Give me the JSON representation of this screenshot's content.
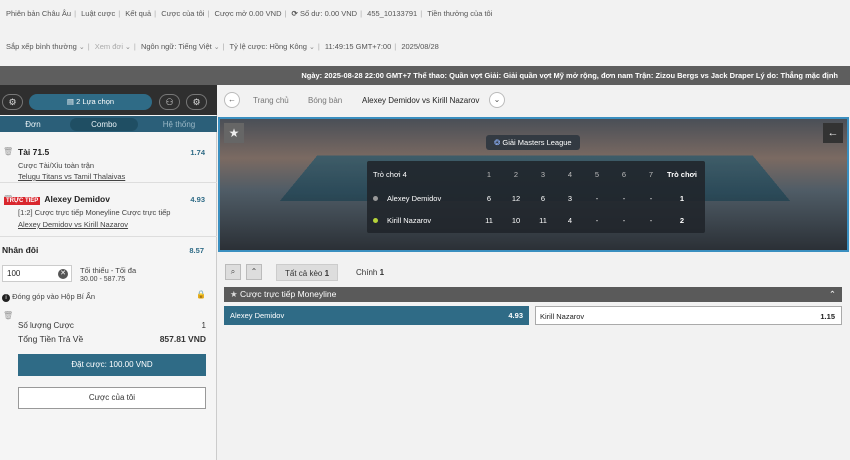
{
  "topbar": {
    "items1": [
      "Phiên bản Châu Âu",
      "Luật cược",
      "Kết quả",
      "Cược của tôi",
      "Cược mở 0.00 VND"
    ],
    "balance_label": "Số dư:",
    "balance_value": "0.00 VND",
    "account_id": "455_10133791",
    "bonus": "Tiền thưởng của tôi",
    "sort": "Sắp xếp bình thường",
    "view": "Xem đơi",
    "lang": "Ngôn ngữ: Tiếng Việt",
    "odds": "Tỷ lệ cược: Hồng Kông",
    "clock": "11:49:15 GMT+7:00",
    "date": "2025/08/28"
  },
  "infobar": "Ngày: 2025-08-28 22:00 GMT+7 Thể thao: Quần vợt Giải: Giải quần vợt Mỹ mở rộng, đơn nam Trận: Zizou Bergs vs Jack Draper Lý do: Thẳng mặc định",
  "betslip": {
    "count_label": "2 Lựa chọn",
    "tabs": [
      "Đơn",
      "Combo",
      "Hệ thống"
    ],
    "bet1": {
      "title": "Tài 71.5",
      "odd": "1.74",
      "market": "Cược Tài/Xỉu toàn trận",
      "match": "Telugu Titans vs Tamil Thalaivas"
    },
    "bet2": {
      "live": "TRỰC TIẾP",
      "title": "Alexey Demidov",
      "odd": "4.93",
      "market": "[1:2] Cược trực tiếp Moneyline Cược trực tiếp",
      "match": "Alexey Demidov vs Kirill Nazarov"
    },
    "double": {
      "title": "Nhân đôi",
      "odd": "8.57",
      "stake": "100",
      "minmax_label": "Tối thiểu - Tối đa",
      "minmax": "30.00 - 587.75"
    },
    "mystery": "Đóng góp vào Hộp Bí Ẩn",
    "count_row": {
      "label": "Số lượng Cược",
      "value": "1"
    },
    "payout_row": {
      "label": "Tổng Tiền Trả Về",
      "value": "857.81 VND"
    },
    "place": "Đặt cược: 100.00 VND",
    "mybets": "Cược của tôi"
  },
  "crumbs": [
    "Trang chủ",
    "Bóng bàn",
    "Alexey Demidov vs Kirill Nazarov"
  ],
  "scoreboard": {
    "league": "Giải Masters League",
    "head": "Trò chơi 4",
    "cols": [
      "1",
      "2",
      "3",
      "4",
      "5",
      "6",
      "7"
    ],
    "total_label": "Trò chơi",
    "players": [
      {
        "name": "Alexey Demidov",
        "scores": [
          "6",
          "12",
          "6",
          "3",
          "-",
          "-",
          "-"
        ],
        "total": "1",
        "color": "#999999"
      },
      {
        "name": "Kirill Nazarov",
        "scores": [
          "11",
          "10",
          "11",
          "4",
          "-",
          "-",
          "-"
        ],
        "total": "2",
        "color": "#b6d33a"
      }
    ]
  },
  "filters": {
    "all": "Tất cả kèo",
    "all_count": "1",
    "main": "Chính",
    "main_count": "1"
  },
  "market": {
    "title": "Cược trực tiếp Moneyline",
    "sel1": {
      "name": "Alexey Demidov",
      "odd": "4.93"
    },
    "sel2": {
      "name": "Kirill Nazarov",
      "odd": "1.15"
    }
  },
  "colors": {
    "accent": "#2f6b86",
    "live": "#d9262d",
    "hero_border": "#3a8fc0"
  }
}
